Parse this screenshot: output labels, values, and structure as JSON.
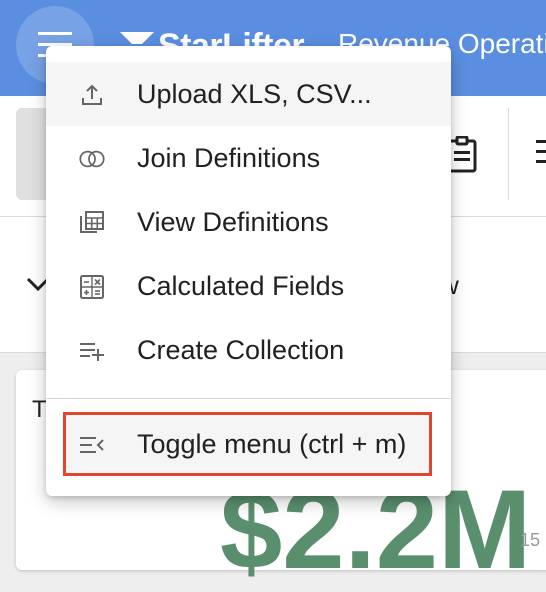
{
  "header": {
    "brand": "StarLifter",
    "title": "Revenue Operations"
  },
  "content": {
    "section_label": "w",
    "card_title": "T",
    "kpi_value": "$2.2M",
    "kpi_side": "15"
  },
  "menu": {
    "items": [
      {
        "label": "Upload XLS, CSV...",
        "icon": "upload-icon"
      },
      {
        "label": "Join Definitions",
        "icon": "join-icon"
      },
      {
        "label": "View Definitions",
        "icon": "table-icon"
      },
      {
        "label": "Calculated Fields",
        "icon": "calculator-icon"
      },
      {
        "label": "Create Collection",
        "icon": "playlist-add-icon"
      }
    ],
    "toggle": {
      "label": "Toggle menu (ctrl + m)",
      "icon": "menu-collapse-icon"
    }
  },
  "colors": {
    "header": "#5a8ee0",
    "kpi": "#5a8f6e",
    "highlight": "#e0452f"
  }
}
